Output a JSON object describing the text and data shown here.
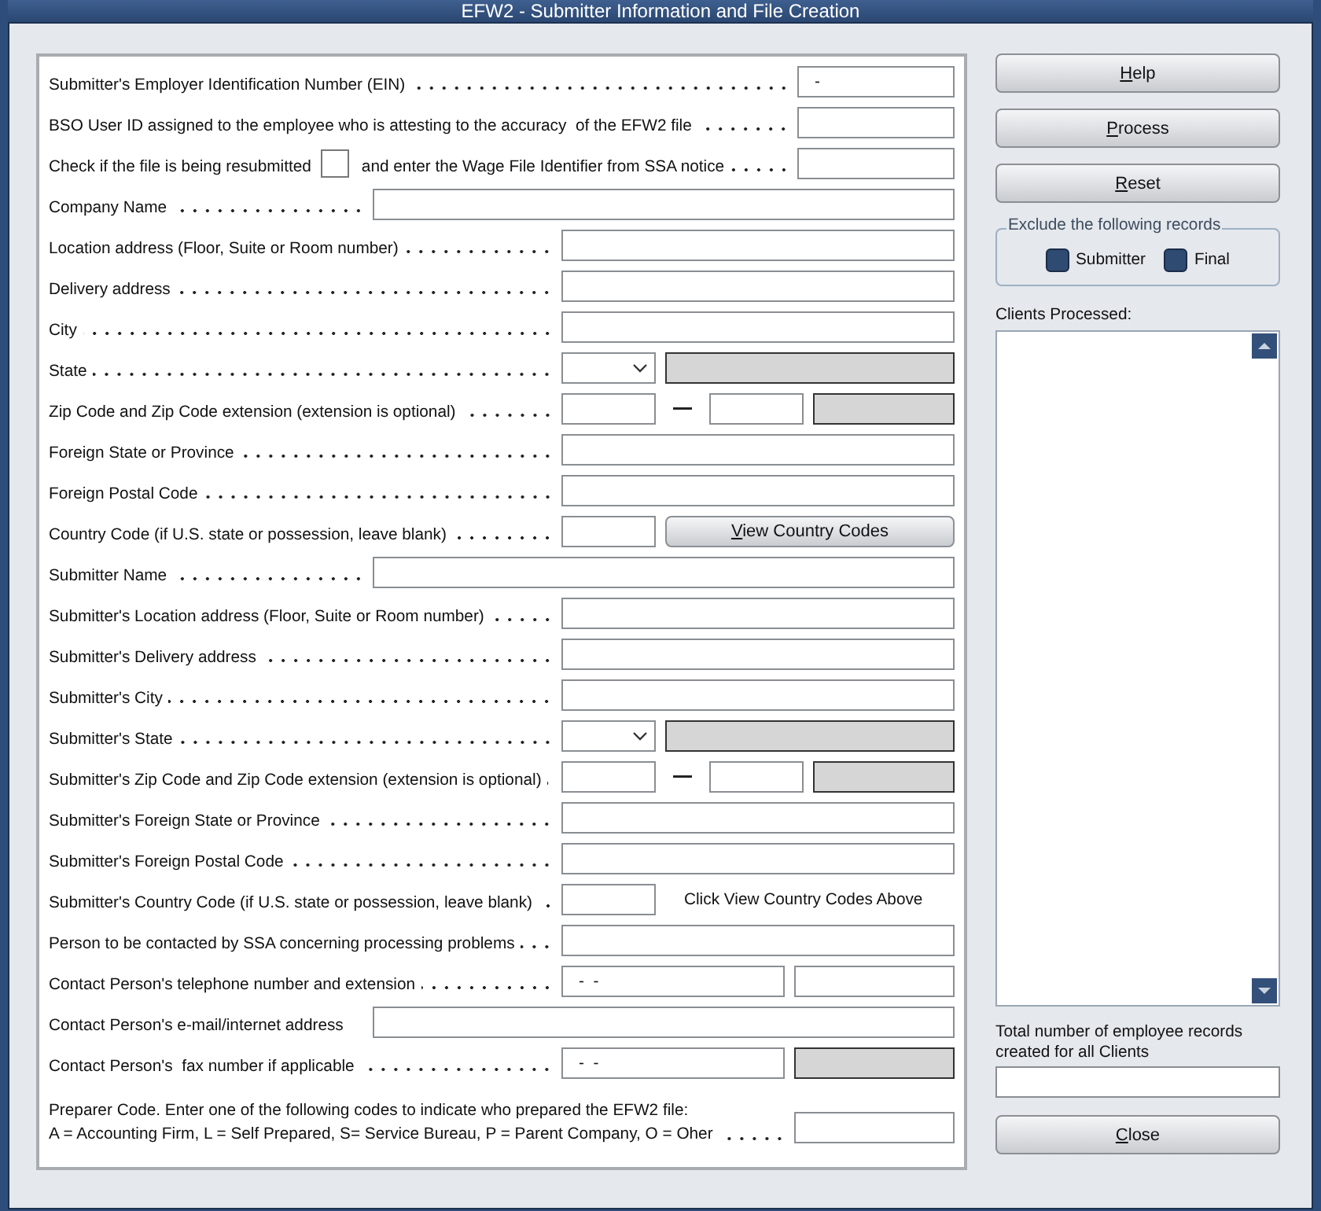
{
  "window": {
    "title": "EFW2 - Submitter Information and File Creation"
  },
  "form": {
    "rows": [
      {
        "kind": "short",
        "label": "Submitter's Employer Identification Number (EIN)",
        "value": "-"
      },
      {
        "kind": "short",
        "label": "BSO User ID assigned to the employee who is attesting to the accuracy  of the EFW2 file"
      },
      {
        "kind": "resubmit",
        "label": "Check if the file is being resubmitted",
        "label_after": "and enter the Wage File Identifier from SSA notice",
        "checked": false
      },
      {
        "kind": "wide",
        "label": "Company Name"
      },
      {
        "kind": "text",
        "label": "Location address (Floor, Suite or Room number)"
      },
      {
        "kind": "text",
        "label": "Delivery address"
      },
      {
        "kind": "text",
        "label": "City"
      },
      {
        "kind": "state",
        "label": "State"
      },
      {
        "kind": "zip",
        "label": "Zip Code and Zip Code extension (extension is optional)"
      },
      {
        "kind": "text",
        "label": "Foreign State or Province"
      },
      {
        "kind": "text",
        "label": "Foreign Postal Code"
      },
      {
        "kind": "country",
        "label": "Country Code (if U.S. state or possession, leave blank)",
        "button": "View Country Codes"
      },
      {
        "kind": "wide",
        "label": "Submitter Name"
      },
      {
        "kind": "text",
        "label": "Submitter's Location address (Floor, Suite or Room number)"
      },
      {
        "kind": "text",
        "label": "Submitter's Delivery address"
      },
      {
        "kind": "text",
        "label": "Submitter's City"
      },
      {
        "kind": "state",
        "label": "Submitter's State"
      },
      {
        "kind": "zip",
        "label": "Submitter's Zip Code and Zip Code extension (extension is optional)"
      },
      {
        "kind": "text",
        "label": "Submitter's Foreign State or Province"
      },
      {
        "kind": "text",
        "label": "Submitter's Foreign Postal Code"
      },
      {
        "kind": "note",
        "label": "Submitter's Country Code (if U.S. state or possession, leave blank)",
        "note": "Click View Country Codes Above"
      },
      {
        "kind": "text",
        "label": "Person to be contacted by SSA concerning processing problems"
      },
      {
        "kind": "phone",
        "label": "Contact Person's telephone number and extension",
        "value": "-  -"
      },
      {
        "kind": "wide",
        "label": "Contact Person's e-mail/internet address",
        "dotted": false
      },
      {
        "kind": "fax",
        "label": "Contact Person's  fax number if applicable",
        "value": "-  -"
      },
      {
        "kind": "preparer",
        "label": "Preparer Code. Enter one of the following codes to indicate who prepared the EFW2 file:",
        "label_2": "A = Accounting Firm, L = Self Prepared, S= Service Bureau, P = Parent Company, O = Oher"
      }
    ]
  },
  "side": {
    "buttons": [
      "Help",
      "Process",
      "Reset"
    ],
    "exclude": {
      "legend": "Exclude the following records",
      "options": [
        {
          "label": "Submitter",
          "checked": false
        },
        {
          "label": "Final",
          "checked": false
        }
      ]
    },
    "clients_label": "Clients Processed:",
    "total_label": "Total  number of employee  records created for all Clients",
    "close": "Close"
  }
}
